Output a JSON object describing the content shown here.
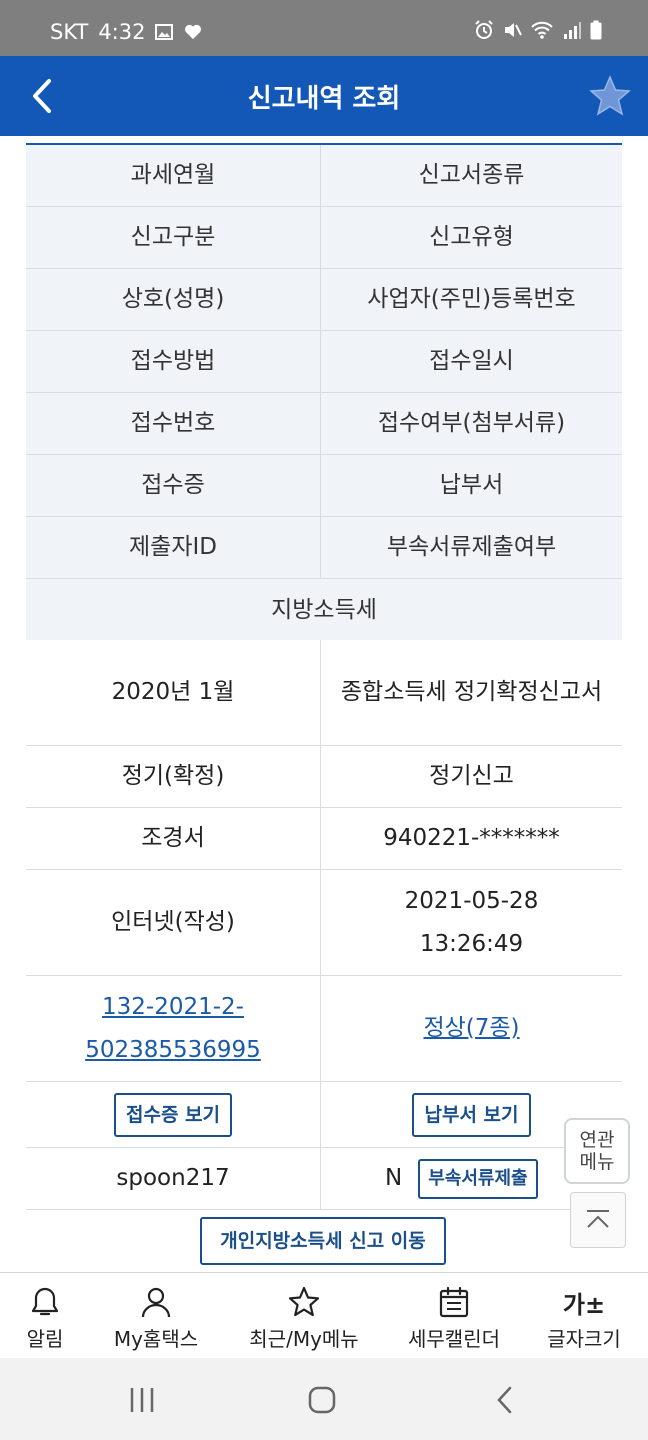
{
  "status_bar": {
    "carrier": "SKT",
    "time": "4:32"
  },
  "header": {
    "title": "신고내역 조회"
  },
  "column_headers": {
    "rows": [
      [
        "과세연월",
        "신고서종류"
      ],
      [
        "신고구분",
        "신고유형"
      ],
      [
        "상호(성명)",
        "사업자(주민)등록번호"
      ],
      [
        "접수방법",
        "접수일시"
      ],
      [
        "접수번호",
        "접수여부(첨부서류)"
      ],
      [
        "접수증",
        "납부서"
      ],
      [
        "제출자ID",
        "부속서류제출여부"
      ]
    ],
    "section": "지방소득세"
  },
  "record": {
    "tax_period": "2020년 1월",
    "report_type": "종합소득세 정기확정신고서",
    "report_category": "정기(확정)",
    "report_kind": "정기신고",
    "name": "조경서",
    "registration_no": "940221-*******",
    "method": "인터넷(작성)",
    "received_date": "2021-05-28",
    "received_time": "13:26:49",
    "receipt_no_line1": "132-2021-2-",
    "receipt_no_line2": "502385536995",
    "status": "정상(7종)",
    "receipt_button": "접수증 보기",
    "payment_button": "납부서 보기",
    "submitter_id": "spoon217",
    "attachment_flag": "N",
    "attachment_button": "부속서류제출"
  },
  "local_tax_button": "개인지방소득세 신고 이동",
  "floating": {
    "related_menu_line1": "연관",
    "related_menu_line2": "메뉴"
  },
  "bottom_nav": {
    "items": [
      {
        "label": "알림",
        "icon": "bell-icon"
      },
      {
        "label": "My홈택스",
        "icon": "person-icon"
      },
      {
        "label": "최근/My메뉴",
        "icon": "star-icon"
      },
      {
        "label": "세무캘린더",
        "icon": "calendar-icon"
      },
      {
        "label": "글자크기",
        "glyph": "가±"
      }
    ]
  },
  "colors": {
    "header": "#1357b7",
    "link": "#1a5aa8",
    "button_border": "#1b4f8a",
    "header_cell_bg": "#f0f4f9"
  }
}
